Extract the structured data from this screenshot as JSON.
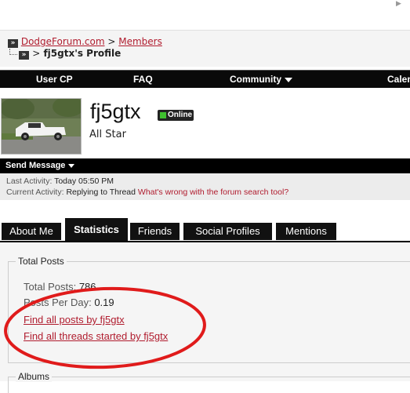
{
  "breadcrumb": {
    "site": "DodgeForum.com",
    "separator": ">",
    "section": "Members",
    "current": "fj5gtx's Profile"
  },
  "nav": {
    "items": [
      "User CP",
      "FAQ",
      "Community",
      "Calen"
    ]
  },
  "profile": {
    "username": "fj5gtx",
    "online_status": "Online",
    "user_title": "All Star"
  },
  "send_message": {
    "label": "Send Message"
  },
  "activity": {
    "last_label": "Last Activity:",
    "last_value": "Today 05:50 PM",
    "current_label": "Current Activity:",
    "current_value": "Replying to Thread",
    "current_link": "What's wrong with the forum search tool?"
  },
  "tabs": [
    "About Me",
    "Statistics",
    "Friends",
    "Social Profiles",
    "Mentions"
  ],
  "statistics": {
    "section_title": "Total Posts",
    "total_posts_label": "Total Posts:",
    "total_posts_value": "786",
    "per_day_label": "Posts Per Day:",
    "per_day_value": "0.19",
    "find_posts": "Find all posts by fj5gtx",
    "find_threads": "Find all threads started by fj5gtx",
    "next_section": "Albums"
  },
  "colors": {
    "link": "#b01c2e",
    "online": "#3fbf2f",
    "annotation": "#e01b1b"
  }
}
